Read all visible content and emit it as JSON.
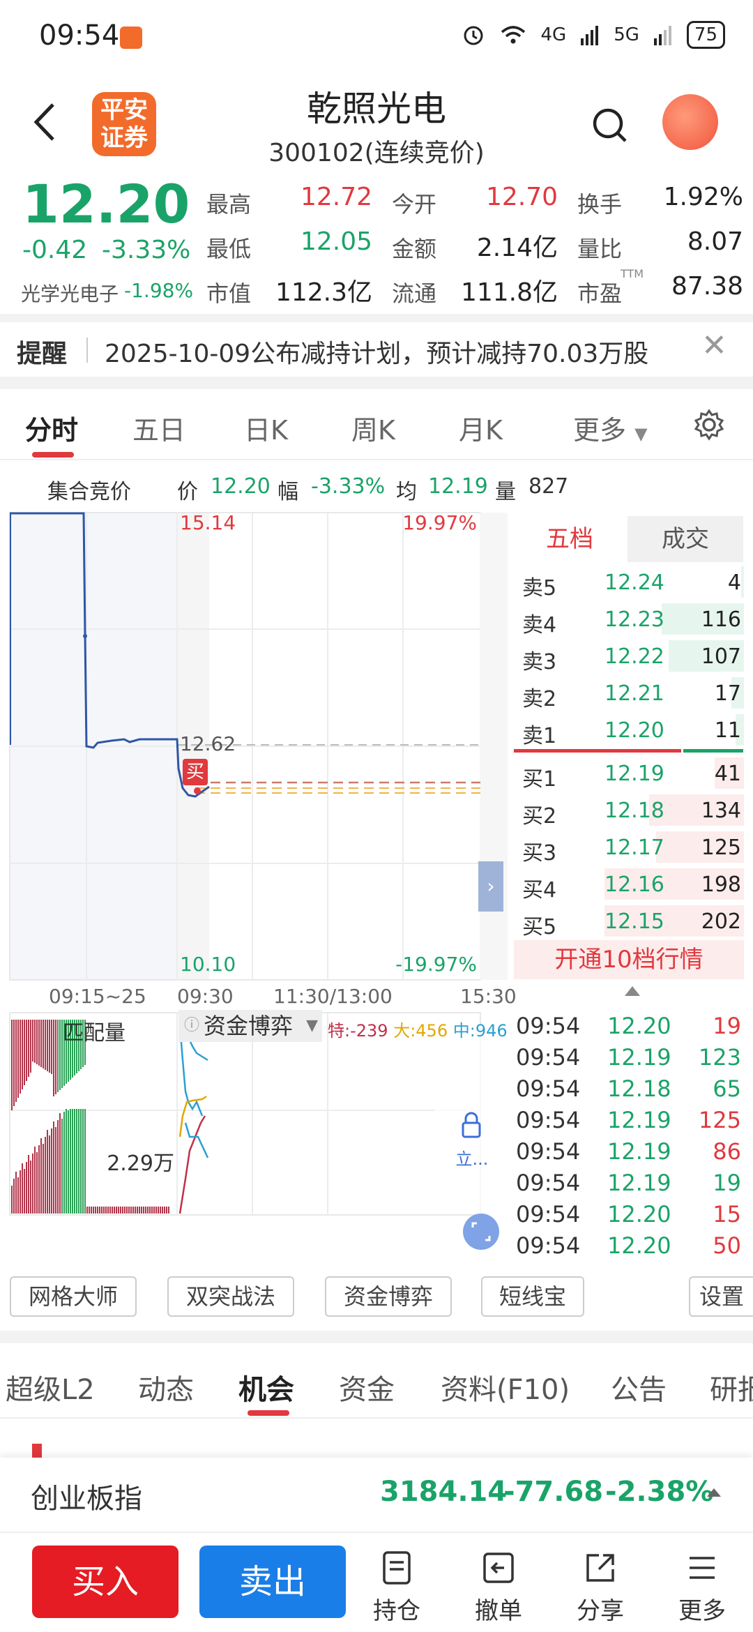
{
  "status": {
    "time": "09:54",
    "net1": "4G",
    "net2": "5G",
    "battery": "75"
  },
  "header": {
    "name": "乾照光电",
    "code": "300102",
    "mode": "(连续竞价)",
    "logo_line1": "平安",
    "logo_line2": "证券"
  },
  "quote": {
    "price": "12.20",
    "change": "-0.42",
    "change_pct": "-3.33%",
    "sector_label": "光学光电子",
    "sector_change": "-1.98%",
    "fields": [
      {
        "label": "最高",
        "value": "12.72",
        "color": "#e0393e"
      },
      {
        "label": "今开",
        "value": "12.70",
        "color": "#e0393e"
      },
      {
        "label": "换手",
        "value": "1.92%",
        "color": "#222"
      },
      {
        "label": "最低",
        "value": "12.05",
        "color": "#1aa368"
      },
      {
        "label": "金额",
        "value": "2.14亿",
        "color": "#222"
      },
      {
        "label": "量比",
        "value": "8.07",
        "color": "#222"
      },
      {
        "label": "市值",
        "value": "112.3亿",
        "color": "#222"
      },
      {
        "label": "流通",
        "value": "111.8亿",
        "color": "#222"
      },
      {
        "label": "市盈",
        "value": "87.38",
        "color": "#222"
      }
    ],
    "ttm": "TTM"
  },
  "reminder": {
    "label": "提醒",
    "text": "2025-10-09公布减持计划，预计减持70.03万股"
  },
  "chart_tabs": [
    "分时",
    "五日",
    "日K",
    "周K",
    "月K",
    "更多"
  ],
  "info_line": {
    "auction": "集合竞价",
    "price_label": "价",
    "price": "12.20",
    "range_label": "幅",
    "range": "-3.33%",
    "avg_label": "均",
    "avg": "12.19",
    "vol_label": "量",
    "vol": "827"
  },
  "chart_labels": {
    "top_price": "15.14",
    "top_pct": "19.97%",
    "ref_price": "12.62",
    "bottom_price": "10.10",
    "bottom_pct": "-19.97%",
    "buy_marker": "买",
    "volume_label": "2.29万"
  },
  "time_axis": [
    "09:15~25",
    "09:30",
    "11:30/13:00",
    "15:30"
  ],
  "order_book": {
    "tabs": [
      "五档",
      "成交"
    ],
    "asks": [
      {
        "label": "卖5",
        "price": "12.24",
        "vol": "4",
        "fill": 0.02
      },
      {
        "label": "卖4",
        "price": "12.23",
        "vol": "116",
        "fill": 0.59
      },
      {
        "label": "卖3",
        "price": "12.22",
        "vol": "107",
        "fill": 0.54
      },
      {
        "label": "卖2",
        "price": "12.21",
        "vol": "17",
        "fill": 0.09
      },
      {
        "label": "卖1",
        "price": "12.20",
        "vol": "11",
        "fill": 0.06
      }
    ],
    "bids": [
      {
        "label": "买1",
        "price": "12.19",
        "vol": "41",
        "fill": 0.21
      },
      {
        "label": "买2",
        "price": "12.18",
        "vol": "134",
        "fill": 0.68
      },
      {
        "label": "买3",
        "price": "12.17",
        "vol": "125",
        "fill": 0.63
      },
      {
        "label": "买4",
        "price": "12.16",
        "vol": "198",
        "fill": 1.0
      },
      {
        "label": "买5",
        "price": "12.15",
        "vol": "202",
        "fill": 1.0
      }
    ],
    "upgrade": "开通10档行情"
  },
  "volume_panel": {
    "match_label": "匹配量",
    "dropdown": "资金博弈",
    "legend": [
      {
        "label": "特:-239",
        "color": "#c0304a"
      },
      {
        "label": "大:456",
        "color": "#e0a800"
      },
      {
        "label": "中:946",
        "color": "#2aa0d0"
      }
    ],
    "lock_text": "立..."
  },
  "trades": [
    {
      "time": "09:54",
      "price": "12.20",
      "vol": "19",
      "color": "#e0393e"
    },
    {
      "time": "09:54",
      "price": "12.19",
      "vol": "123",
      "color": "#1aa368"
    },
    {
      "time": "09:54",
      "price": "12.18",
      "vol": "65",
      "color": "#1aa368"
    },
    {
      "time": "09:54",
      "price": "12.19",
      "vol": "125",
      "color": "#e0393e"
    },
    {
      "time": "09:54",
      "price": "12.19",
      "vol": "86",
      "color": "#e0393e"
    },
    {
      "time": "09:54",
      "price": "12.19",
      "vol": "19",
      "color": "#1aa368"
    },
    {
      "time": "09:54",
      "price": "12.20",
      "vol": "15",
      "color": "#e0393e"
    },
    {
      "time": "09:54",
      "price": "12.20",
      "vol": "50",
      "color": "#e0393e"
    }
  ],
  "tools": [
    "网格大师",
    "双突战法",
    "资金博弈",
    "短线宝",
    "设置"
  ],
  "info_tabs": [
    "超级L2",
    "动态",
    "机会",
    "资金",
    "资料(F10)",
    "公告",
    "研报"
  ],
  "index": {
    "name": "创业板指",
    "value": "3184.14",
    "change": "-77.68",
    "pct": "-2.38%"
  },
  "bottom": {
    "buy": "买入",
    "sell": "卖出",
    "nav": [
      "持仓",
      "撤单",
      "分享",
      "更多"
    ]
  },
  "colors": {
    "up": "#e0393e",
    "down": "#1aa368",
    "buy_btn": "#e51c23",
    "sell_btn": "#1a7ee8",
    "brand": "#f26b2a"
  }
}
